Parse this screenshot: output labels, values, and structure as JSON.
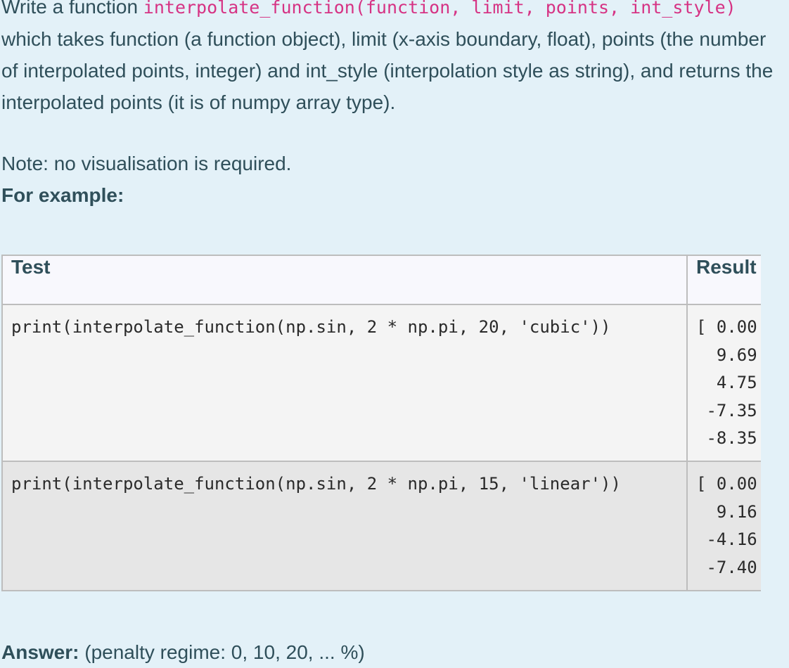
{
  "description": {
    "prefix": "Write a function ",
    "signature": "interpolate_function(function, limit, points, int_style)",
    "suffix": " which takes function (a function object), limit (x-axis boundary, float), points (the number of interpolated points, integer) and int_style (interpolation style as string), and returns the interpolated points (it is of numpy array type)."
  },
  "note": "Note: no visualisation is required.",
  "example_heading": "For example:",
  "table": {
    "headers": [
      "Test",
      "Result"
    ],
    "rows": [
      {
        "test": "print(interpolate_function(np.sin, 2 * np.pi, 20, 'cubic'))",
        "result": [
          "[ 0.00",
          "  9.69",
          "  4.75",
          " -7.35",
          " -8.35"
        ]
      },
      {
        "test": "print(interpolate_function(np.sin, 2 * np.pi, 15, 'linear'))",
        "result": [
          "[ 0.00",
          "  9.16",
          " -4.16",
          " -7.40"
        ]
      }
    ]
  },
  "answer": {
    "label": "Answer:",
    "penalty": "(penalty regime: 0, 10, 20, ... %)"
  }
}
